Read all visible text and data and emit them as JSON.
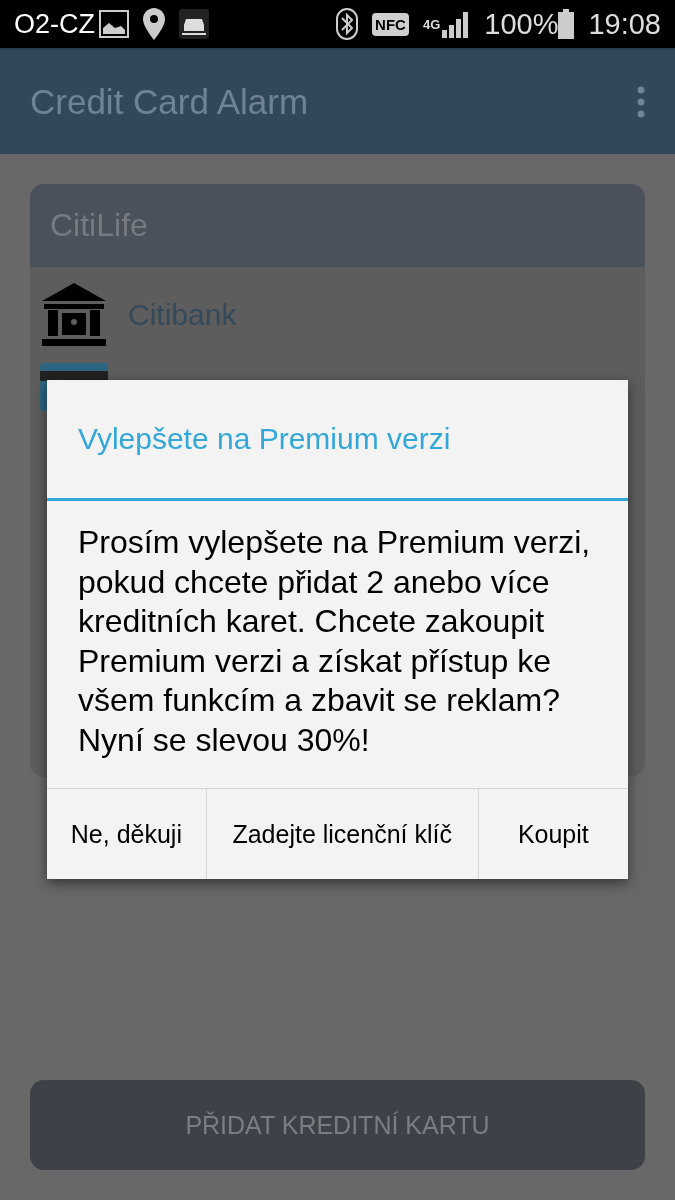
{
  "status_bar": {
    "carrier": "O2-CZ",
    "nfc": "NFC",
    "network": "4G",
    "battery": "100%",
    "time": "19:08"
  },
  "app_bar": {
    "title": "Credit Card Alarm"
  },
  "card": {
    "title": "CitiLife",
    "rows": [
      {
        "kind": "bank",
        "label": "Citibank"
      },
      {
        "kind": "card"
      }
    ]
  },
  "dialog": {
    "title": "Vylepšete na Premium verzi",
    "message": "Prosím vylepšete na Premium verzi, pokud chcete přidat 2 anebo více kreditních karet. Chcete zakoupit Premium verzi a získat přístup ke všem funkcím a zbavit se reklam? Nyní se slevou 30%!",
    "buttons": [
      "Ne, děkuji",
      "Zadejte licenční klíč",
      "Koupit"
    ]
  },
  "add_button": "PŘIDAT KREDITNÍ KARTU"
}
